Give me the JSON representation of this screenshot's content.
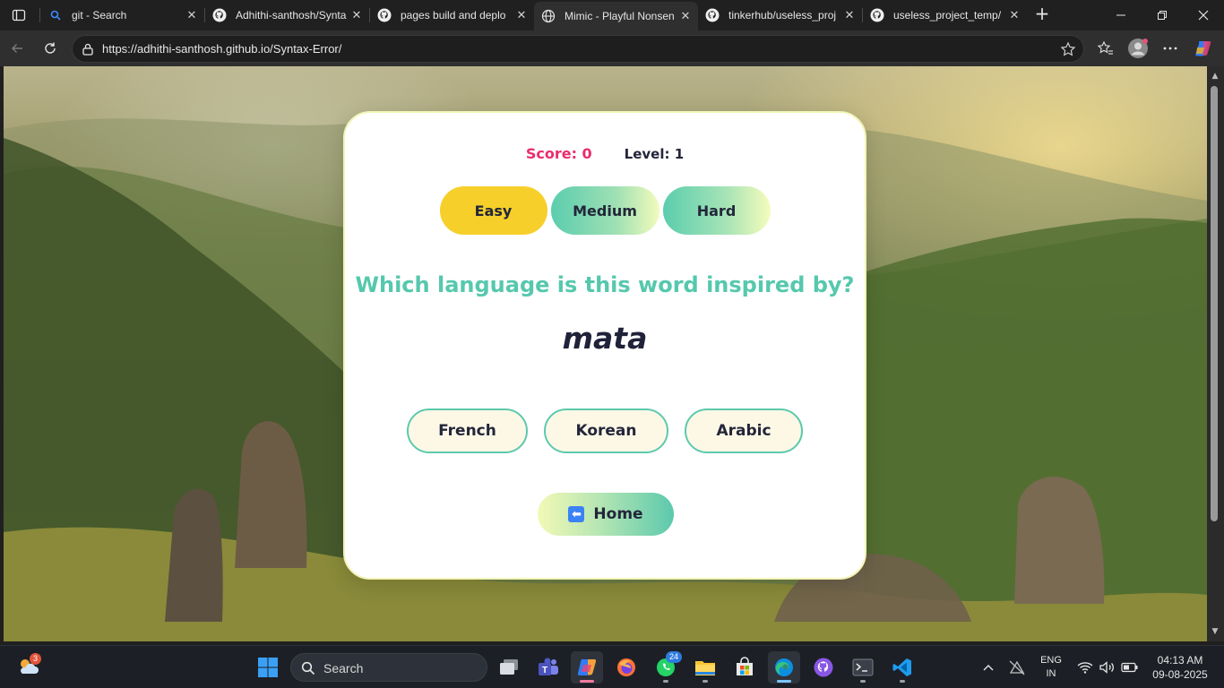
{
  "browser": {
    "tabs": [
      {
        "title": "git - Search",
        "icon": "search-icon",
        "active": false
      },
      {
        "title": "Adhithi-santhosh/Synta",
        "icon": "github-icon",
        "active": false
      },
      {
        "title": "pages build and deplo",
        "icon": "github-icon",
        "active": false
      },
      {
        "title": "Mimic - Playful Nonsen",
        "icon": "globe-icon",
        "active": true
      },
      {
        "title": "tinkerhub/useless_proj",
        "icon": "github-icon",
        "active": false
      },
      {
        "title": "useless_project_temp/",
        "icon": "github-icon",
        "active": false
      }
    ],
    "url": "https://adhithi-santhosh.github.io/Syntax-Error/"
  },
  "game": {
    "score_label": "Score: 0",
    "level_label": "Level: 1",
    "difficulties": [
      "Easy",
      "Medium",
      "Hard"
    ],
    "selected_difficulty": "Easy",
    "question": "Which language is this word inspired by?",
    "word": "mata",
    "options": [
      "French",
      "Korean",
      "Arabic"
    ],
    "home_label": "Home",
    "colors": {
      "score": "#ea2c6d",
      "question": "#56c8ad",
      "easy": "#f6cf2a",
      "accent": "#5cc9ad"
    }
  },
  "taskbar": {
    "search_label": "Search",
    "weather_badge": "3",
    "whatsapp_badge": "24",
    "lang_line1": "ENG",
    "lang_line2": "IN",
    "time": "04:13 AM",
    "date": "09-08-2025"
  }
}
